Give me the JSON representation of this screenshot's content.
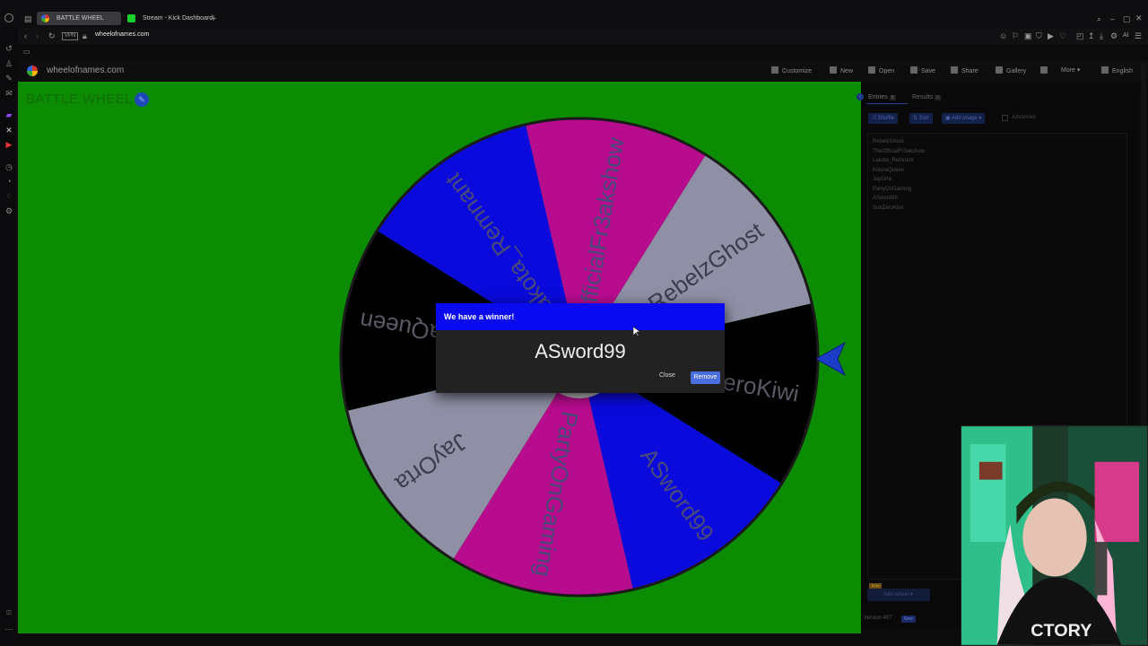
{
  "browser": {
    "tabs": [
      {
        "label": "BATTLE WHEEL",
        "active": true
      },
      {
        "label": "Stream - Kick Dashboard",
        "active": false
      }
    ],
    "url": "wheelofnames.com",
    "vpn_label": "VPN"
  },
  "site": {
    "name": "wheelofnames.com",
    "menu": [
      "Customize",
      "New",
      "Open",
      "Save",
      "Share",
      "Gallery",
      "More",
      "English"
    ]
  },
  "wheel": {
    "title": "BATTLE WHEEL",
    "segments": [
      {
        "name": "RebelzGhost",
        "color": "#8f8fa6"
      },
      {
        "name": "SubZeroKiwi",
        "color": "#000000"
      },
      {
        "name": "ASword99",
        "color": "#0a0adc"
      },
      {
        "name": "PartyOnGaming",
        "color": "#b80c8e"
      },
      {
        "name": "JayOrta",
        "color": "#8f8fa6"
      },
      {
        "name": "KitanaQueen",
        "color": "#000000"
      },
      {
        "name": "Lakota_Remnant",
        "color": "#0a0adc"
      },
      {
        "name": "TheOfficialFr3akshow",
        "color": "#b80c8e"
      }
    ]
  },
  "dialog": {
    "title": "We have a winner!",
    "winner": "ASword99",
    "close_label": "Close",
    "remove_label": "Remove",
    "header_color": "#0a0af0"
  },
  "panel": {
    "tabs": [
      {
        "label": "Entries",
        "count": "8"
      },
      {
        "label": "Results",
        "count": "0"
      }
    ],
    "buttons": [
      "Shuffle",
      "Sort",
      "Add image"
    ],
    "advanced_label": "Advanced",
    "entries": [
      "RebelzGhost",
      "TheOfficialFr3akshow",
      "Lakota_Remnant",
      "KitanaQueen",
      "JayOrta",
      "PartyOnGaming",
      "ASword99",
      "SubZeroKiwi"
    ],
    "beta_label": "Beta",
    "add_wheel_label": "Add wheel",
    "version": "Version 407",
    "version_badge": "New"
  }
}
